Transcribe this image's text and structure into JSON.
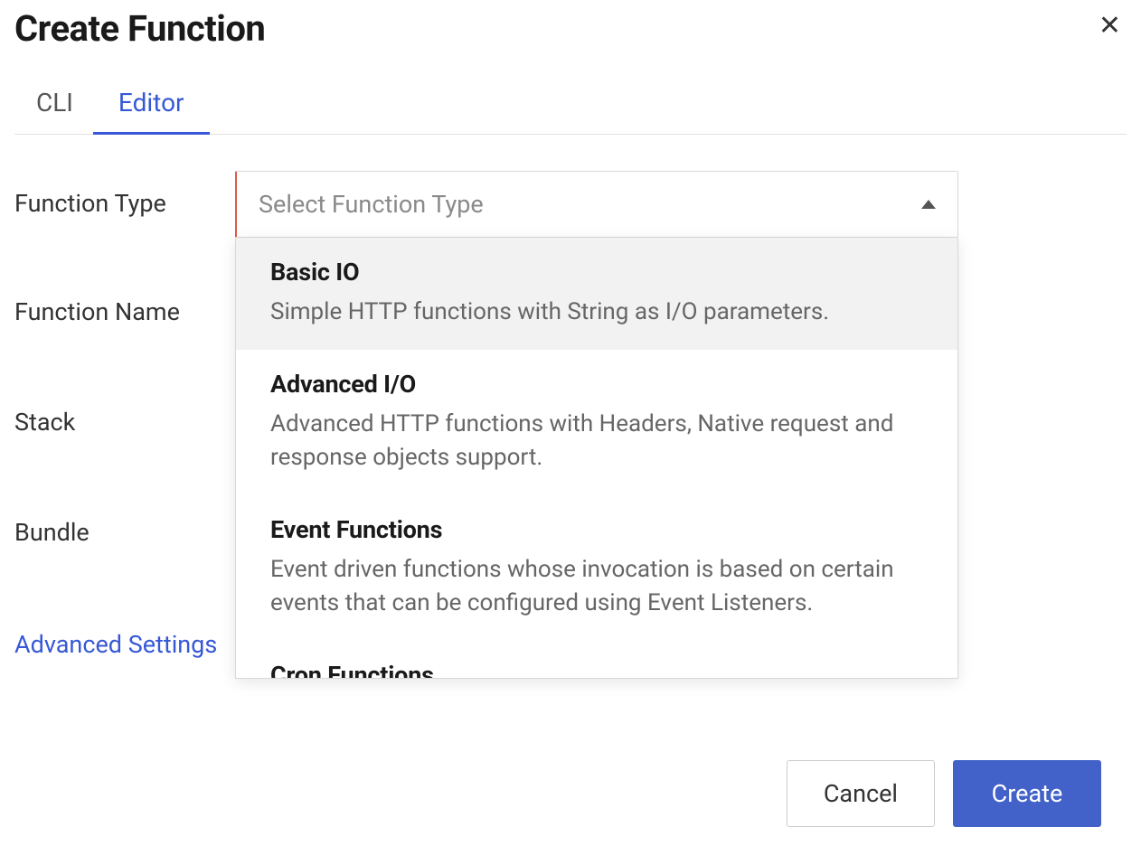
{
  "dialog": {
    "title": "Create Function",
    "close_icon": "✕"
  },
  "tabs": {
    "items": [
      {
        "label": "CLI",
        "active": false
      },
      {
        "label": "Editor",
        "active": true
      }
    ]
  },
  "form": {
    "function_type_label": "Function Type",
    "function_name_label": "Function Name",
    "stack_label": "Stack",
    "bundle_label": "Bundle",
    "function_type_select": {
      "placeholder": "Select Function Type",
      "options": [
        {
          "title": "Basic IO",
          "desc": "Simple HTTP functions with String as I/O parameters."
        },
        {
          "title": "Advanced I/O",
          "desc": "Advanced HTTP functions with Headers, Native request and response objects support."
        },
        {
          "title": "Event Functions",
          "desc": "Event driven functions whose invocation is based on certain events that can be configured using Event Listeners."
        },
        {
          "title": "Cron Functions",
          "desc": ""
        }
      ]
    },
    "advanced_settings_label": "Advanced Settings"
  },
  "footer": {
    "cancel_label": "Cancel",
    "create_label": "Create"
  }
}
